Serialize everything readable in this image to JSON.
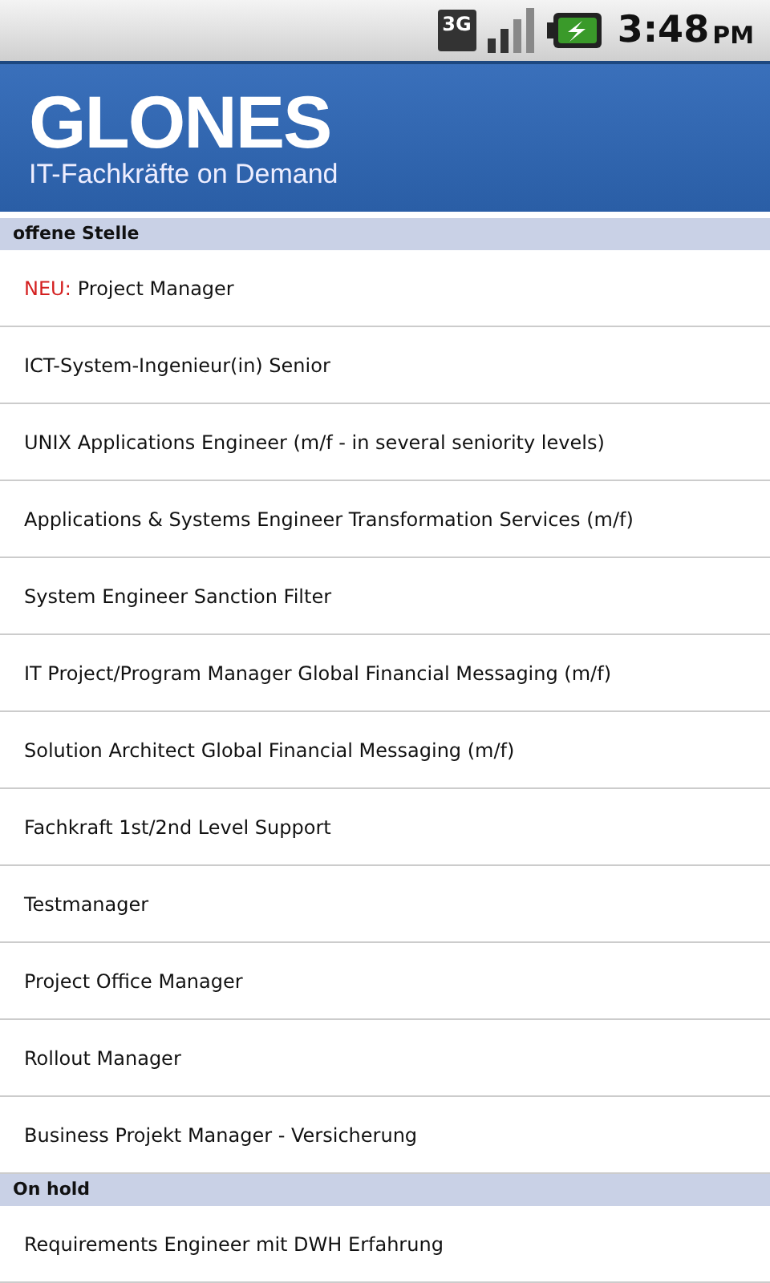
{
  "status_bar": {
    "network_type": "3G",
    "time": "3:48",
    "meridiem": "PM"
  },
  "header": {
    "logo": "GLONES",
    "tagline": "IT-Fachkräfte on Demand"
  },
  "sections": [
    {
      "title": "offene Stelle",
      "items": [
        {
          "badge": "NEU:",
          "title": "Project Manager"
        },
        {
          "title": "ICT-System-Ingenieur(in) Senior"
        },
        {
          "title": "UNIX Applications Engineer (m/f - in several seniority levels)"
        },
        {
          "title": "Applications & Systems Engineer Transformation Services (m/f)"
        },
        {
          "title": "System Engineer Sanction Filter"
        },
        {
          "title": "IT Project/Program Manager Global Financial Messaging (m/f)"
        },
        {
          "title": "Solution Architect Global Financial Messaging (m/f)"
        },
        {
          "title": "Fachkraft 1st/2nd Level Support"
        },
        {
          "title": "Testmanager"
        },
        {
          "title": "Project Office Manager"
        },
        {
          "title": "Rollout Manager"
        },
        {
          "title": "Business Projekt Manager - Versicherung"
        }
      ]
    },
    {
      "title": "On hold",
      "items": [
        {
          "title": "Requirements Engineer mit DWH Erfahrung"
        }
      ]
    }
  ]
}
